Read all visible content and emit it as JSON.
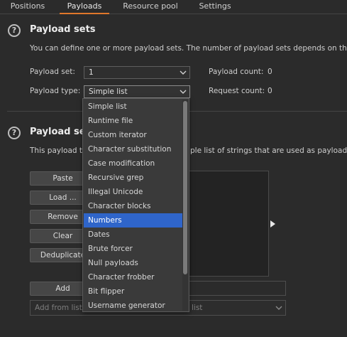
{
  "tabs": [
    {
      "label": "Positions"
    },
    {
      "label": "Payloads"
    },
    {
      "label": "Resource pool"
    },
    {
      "label": "Settings"
    }
  ],
  "payload_sets": {
    "title": "Payload sets",
    "description": "You can define one or more payload sets. The number of payload sets depends on the",
    "set_label": "Payload set:",
    "set_value": "1",
    "type_label": "Payload type:",
    "type_value": "Simple list",
    "count_label": "Payload count:",
    "count_value": "0",
    "request_label": "Request count:",
    "request_value": "0"
  },
  "payload_settings": {
    "title": "Payload set",
    "description_left": "This payload t",
    "description_right": "ple list of strings that are used as payloads."
  },
  "buttons": {
    "paste": "Paste",
    "load": "Load ...",
    "remove": "Remove",
    "clear": "Clear",
    "deduplicate": "Deduplicate",
    "add": "Add"
  },
  "add_from_list": {
    "placeholder_left": "Add from list",
    "placeholder_right": "list"
  },
  "dropdown": {
    "selected_index": 8,
    "items": [
      "Simple list",
      "Runtime file",
      "Custom iterator",
      "Character substitution",
      "Case modification",
      "Recursive grep",
      "Illegal Unicode",
      "Character blocks",
      "Numbers",
      "Dates",
      "Brute forcer",
      "Null payloads",
      "Character frobber",
      "Bit flipper",
      "Username generator"
    ]
  },
  "colors": {
    "accent": "#e0782b",
    "selection": "#2f65ca",
    "background": "#2b2b2b"
  },
  "icons": [
    "help-icon",
    "chevron-down-icon",
    "arrow-right-icon"
  ]
}
